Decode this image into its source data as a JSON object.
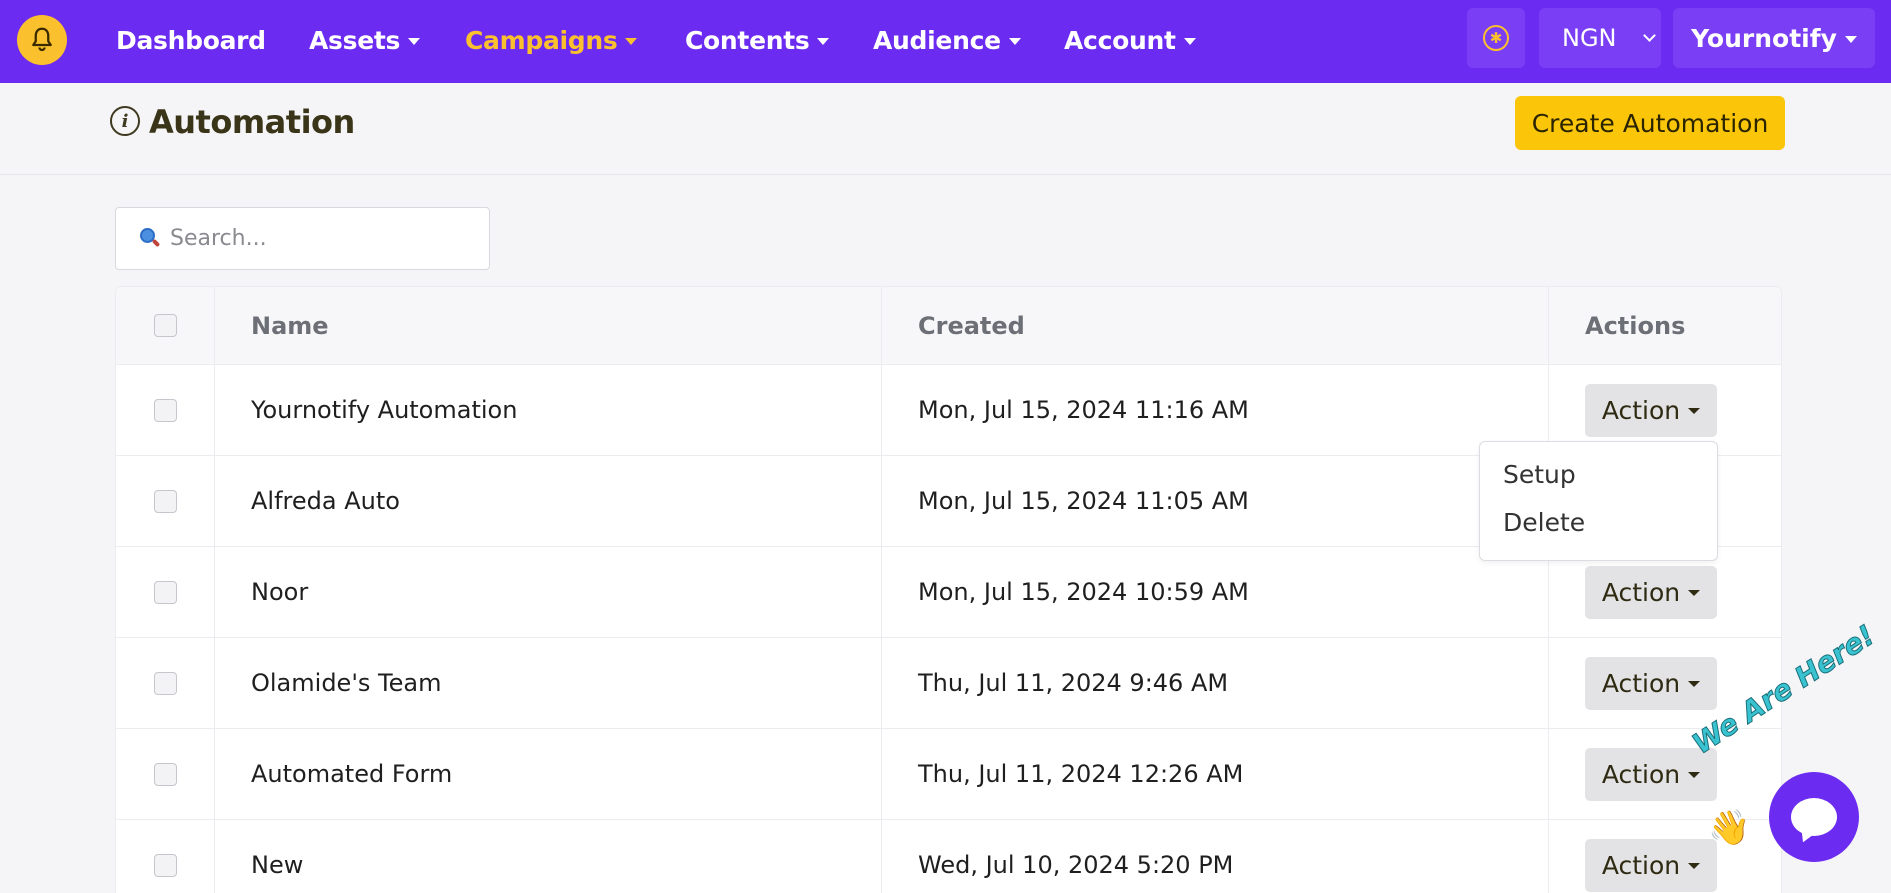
{
  "nav": {
    "items": [
      {
        "label": "Dashboard",
        "dropdown": false,
        "active": false
      },
      {
        "label": "Assets",
        "dropdown": true,
        "active": false
      },
      {
        "label": "Campaigns",
        "dropdown": true,
        "active": true
      },
      {
        "label": "Contents",
        "dropdown": true,
        "active": false
      },
      {
        "label": "Audience",
        "dropdown": true,
        "active": false
      },
      {
        "label": "Account",
        "dropdown": true,
        "active": false
      }
    ],
    "currency": "NGN",
    "account_name": "Yournotify",
    "icons": {
      "logo": "bell-icon",
      "accessibility": "accessibility-icon"
    }
  },
  "page": {
    "title": "Automation",
    "create_button": "Create Automation"
  },
  "search": {
    "placeholder": "Search..."
  },
  "table": {
    "columns": [
      "Name",
      "Created",
      "Actions"
    ],
    "action_label": "Action",
    "rows": [
      {
        "name": "Yournotify Automation",
        "created": "Mon, Jul 15, 2024 11:16 AM"
      },
      {
        "name": "Alfreda Auto",
        "created": "Mon, Jul 15, 2024 11:05 AM"
      },
      {
        "name": "Noor",
        "created": "Mon, Jul 15, 2024 10:59 AM"
      },
      {
        "name": "Olamide's Team",
        "created": "Thu, Jul 11, 2024 9:46 AM"
      },
      {
        "name": "Automated Form",
        "created": "Thu, Jul 11, 2024 12:26 AM"
      },
      {
        "name": "New",
        "created": "Wed, Jul 10, 2024 5:20 PM"
      }
    ]
  },
  "action_menu": {
    "open_for_row": 0,
    "items": [
      "Setup",
      "Delete"
    ]
  },
  "chat_widget": {
    "tagline": "We Are Here!",
    "wave": "👋"
  },
  "colors": {
    "nav_bg": "#6b2bf0",
    "accent": "#fbc609",
    "active_nav": "#fbc02d"
  }
}
